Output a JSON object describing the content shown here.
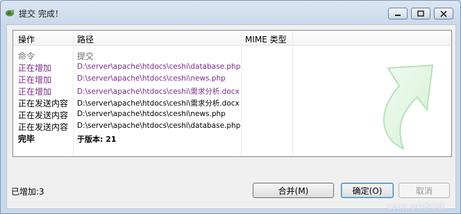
{
  "window": {
    "title": "提交 完成！"
  },
  "columns": {
    "op": "操作",
    "path": "路径",
    "mime": "MIME 类型"
  },
  "rows": [
    {
      "op": "命令",
      "path": "提交",
      "style": "gray"
    },
    {
      "op": "正在增加",
      "path": "D:\\server\\apache\\htdocs\\ceshi\\database.php",
      "style": "purple"
    },
    {
      "op": "正在增加",
      "path": "D:\\server\\apache\\htdocs\\ceshi\\news.php",
      "style": "purple"
    },
    {
      "op": "正在增加",
      "path": "D:\\server\\apache\\htdocs\\ceshi\\需求分析.docx",
      "style": "purple"
    },
    {
      "op": "正在发送内容",
      "path": "D:\\server\\apache\\htdocs\\ceshi\\需求分析.docx",
      "style": "black"
    },
    {
      "op": "正在发送内容",
      "path": "D:\\server\\apache\\htdocs\\ceshi\\news.php",
      "style": "black"
    },
    {
      "op": "正在发送内容",
      "path": "D:\\server\\apache\\htdocs\\ceshi\\database.php",
      "style": "black"
    },
    {
      "op": "完毕",
      "path": "于版本: 21",
      "style": "bold"
    }
  ],
  "status": {
    "added": "已增加:3"
  },
  "buttons": {
    "merge": "合并(M)",
    "ok": "确定(O)",
    "cancel": "取消"
  },
  "watermark": "CSDN @薪香拿铁",
  "icons": {
    "app": "tortoise-svn-icon",
    "arrow": "commit-arrow-icon"
  },
  "colors": {
    "purple": "#7b2a8a",
    "gray": "#6d6d6d",
    "ok_border": "#3c7fb1"
  }
}
